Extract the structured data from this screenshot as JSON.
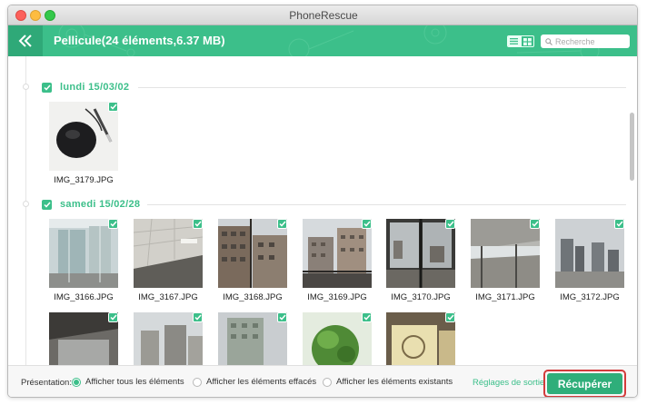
{
  "window": {
    "title": "PhoneRescue"
  },
  "header": {
    "title": "Pellicule(24 éléments,6.37 MB)",
    "search_placeholder": "Recherche",
    "accent": "#3cbf8a"
  },
  "groups": [
    {
      "label": "lundi 15/03/02",
      "items": [
        "IMG_3179.JPG"
      ]
    },
    {
      "label": "samedi 15/02/28",
      "items": [
        "IMG_3166.JPG",
        "IMG_3167.JPG",
        "IMG_3168.JPG",
        "IMG_3169.JPG",
        "IMG_3170.JPG",
        "IMG_3171.JPG",
        "IMG_3172.JPG"
      ]
    }
  ],
  "footer": {
    "presentation_label": "Présentation:",
    "options": [
      "Afficher tous les éléments",
      "Afficher les éléments effacés",
      "Afficher les éléments existants"
    ],
    "selected_option": "Afficher tous les éléments",
    "settings_link": "Réglages de sortie",
    "recover_button": "Récupérer"
  }
}
